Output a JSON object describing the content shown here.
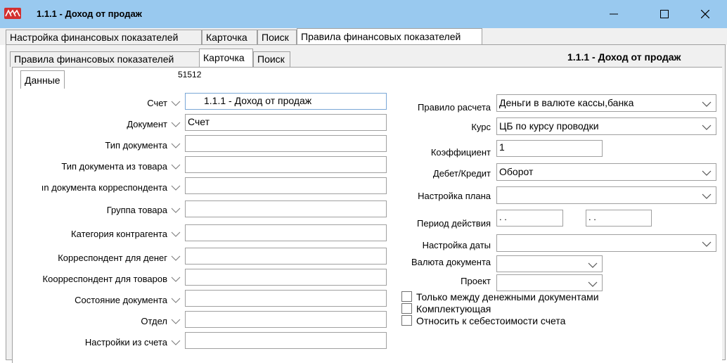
{
  "window": {
    "title": "1.1.1 - Доход от продаж"
  },
  "outer_tabs": [
    {
      "label": "Настройка финансовых показателей"
    },
    {
      "label": "Карточка"
    },
    {
      "label": "Поиск"
    },
    {
      "label": "Правила финансовых показателей"
    }
  ],
  "inner_tabs": [
    {
      "label": "Правила финансовых показателей"
    },
    {
      "label": "Карточка"
    },
    {
      "label": "Поиск"
    }
  ],
  "header": {
    "title": "1.1.1 - Доход от продаж"
  },
  "data_tab": {
    "label": "Данные",
    "code": "51512"
  },
  "left_fields": [
    {
      "label": "Счет",
      "value": "1.1.1 - Доход от продаж"
    },
    {
      "label": "Документ",
      "value": "Счет"
    },
    {
      "label": "Тип документа",
      "value": ""
    },
    {
      "label": "Тип документа из товара",
      "value": ""
    },
    {
      "label": "ın документа корреспондента",
      "value": ""
    },
    {
      "label": "Группа товара",
      "value": ""
    },
    {
      "label": "Категория контрагента",
      "value": ""
    },
    {
      "label": "Корреспондент для денег",
      "value": ""
    },
    {
      "label": "Коорреспондент для товаров",
      "value": ""
    },
    {
      "label": "Состояние документа",
      "value": ""
    },
    {
      "label": "Отдел",
      "value": ""
    },
    {
      "label": "Настройки из счета",
      "value": ""
    }
  ],
  "right_fields": {
    "calc_rule": {
      "label": "Правило расчета",
      "value": "Деньги в валюте кассы,банка"
    },
    "rate": {
      "label": "Курс",
      "value": "ЦБ по курсу проводки"
    },
    "coef": {
      "label": "Коэффициент",
      "value": "1"
    },
    "debit_credit": {
      "label": "Дебет/Кредит",
      "value": "Оборот"
    },
    "plan_setting": {
      "label": "Настройка плана",
      "value": ""
    },
    "period": {
      "label": "Период действия",
      "from": " .  .",
      "to": " .  ."
    },
    "date_setting": {
      "label": "Настройка даты",
      "value": ""
    },
    "doc_currency": {
      "label": "Валюта документа",
      "value": ""
    },
    "project": {
      "label": "Проект",
      "value": ""
    }
  },
  "checkboxes": [
    {
      "label": "Только между денежными документами",
      "checked": false
    },
    {
      "label": "Комплектующая",
      "checked": false
    },
    {
      "label": "Относить к себестоимости счета",
      "checked": false
    }
  ],
  "colors": {
    "titlebar": "#99c9ef",
    "logo": "#d32f2f"
  }
}
